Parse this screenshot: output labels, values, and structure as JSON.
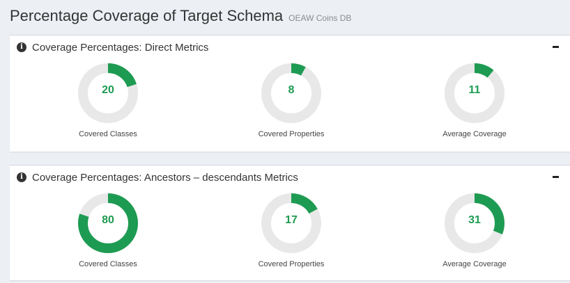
{
  "header": {
    "title": "Percentage Coverage of Target Schema",
    "subtitle": "OEAW Coins DB"
  },
  "colors": {
    "accent": "#1e9b52",
    "track": "#e8e8e8"
  },
  "panels": [
    {
      "title": "Coverage Percentages: Direct Metrics",
      "icon": "info-circle-icon",
      "collapse_icon": "minus-icon",
      "gauges": [
        {
          "value": "20",
          "percent": 20,
          "label": "Covered Classes"
        },
        {
          "value": "8",
          "percent": 8,
          "label": "Covered Properties"
        },
        {
          "value": "11",
          "percent": 11,
          "label": "Average Coverage"
        }
      ]
    },
    {
      "title": "Coverage Percentages: Ancestors – descendants Metrics",
      "icon": "info-circle-icon",
      "collapse_icon": "minus-icon",
      "gauges": [
        {
          "value": "80",
          "percent": 80,
          "label": "Covered Classes"
        },
        {
          "value": "17",
          "percent": 17,
          "label": "Covered Properties"
        },
        {
          "value": "31",
          "percent": 31,
          "label": "Average Coverage"
        }
      ]
    }
  ]
}
